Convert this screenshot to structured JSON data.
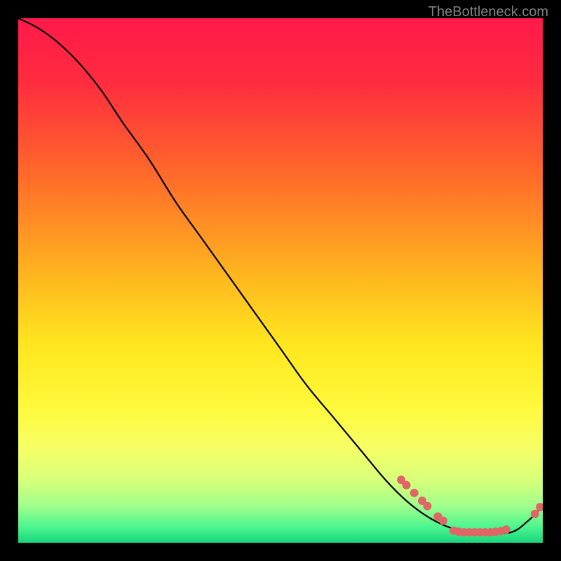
{
  "watermark": "TheBottleneck.com",
  "chart_data": {
    "type": "line",
    "title": "",
    "xlabel": "",
    "ylabel": "",
    "xlim": [
      0,
      100
    ],
    "ylim": [
      0,
      100
    ],
    "gradient_stops": [
      {
        "offset": 0,
        "color": "#ff1a4a"
      },
      {
        "offset": 0.12,
        "color": "#ff2b3f"
      },
      {
        "offset": 0.3,
        "color": "#ff6a2a"
      },
      {
        "offset": 0.48,
        "color": "#ffb21f"
      },
      {
        "offset": 0.62,
        "color": "#ffe61f"
      },
      {
        "offset": 0.74,
        "color": "#fff93a"
      },
      {
        "offset": 0.82,
        "color": "#f6ff66"
      },
      {
        "offset": 0.88,
        "color": "#d8ff7a"
      },
      {
        "offset": 0.93,
        "color": "#a0ff8c"
      },
      {
        "offset": 0.97,
        "color": "#4cf58e"
      },
      {
        "offset": 1.0,
        "color": "#18d67e"
      }
    ],
    "series": [
      {
        "name": "bottleneck-curve",
        "x": [
          0,
          4,
          8,
          12,
          16,
          20,
          25,
          30,
          35,
          40,
          45,
          50,
          55,
          60,
          65,
          70,
          74,
          78,
          82,
          86,
          90,
          94,
          97,
          100
        ],
        "y": [
          100,
          98,
          95,
          91,
          86,
          80,
          73,
          65,
          58,
          51,
          44,
          37,
          30,
          24,
          18,
          12,
          8,
          5,
          3,
          2,
          2,
          2,
          4,
          7
        ]
      }
    ],
    "markers": [
      {
        "x": 73,
        "y": 12
      },
      {
        "x": 74,
        "y": 11
      },
      {
        "x": 75.5,
        "y": 9.5
      },
      {
        "x": 77,
        "y": 8
      },
      {
        "x": 78,
        "y": 7
      },
      {
        "x": 80,
        "y": 5
      },
      {
        "x": 81,
        "y": 4.2
      },
      {
        "x": 83,
        "y": 2.3
      },
      {
        "x": 84,
        "y": 2.1
      },
      {
        "x": 85,
        "y": 2
      },
      {
        "x": 86,
        "y": 2
      },
      {
        "x": 87,
        "y": 2
      },
      {
        "x": 88,
        "y": 2
      },
      {
        "x": 89,
        "y": 2
      },
      {
        "x": 90,
        "y": 2
      },
      {
        "x": 91,
        "y": 2.1
      },
      {
        "x": 92,
        "y": 2.2
      },
      {
        "x": 93,
        "y": 2.5
      },
      {
        "x": 98.5,
        "y": 5.5
      },
      {
        "x": 99.5,
        "y": 6.8
      }
    ],
    "marker_color": "#e06666",
    "marker_radius": 6,
    "line_color": "#000000"
  }
}
